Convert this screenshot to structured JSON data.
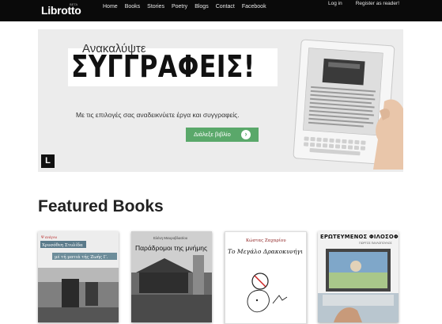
{
  "header": {
    "logo": "Librotto",
    "beta": "BETA",
    "nav": [
      "Home",
      "Books",
      "Stories",
      "Poetry",
      "Blogs",
      "Contact",
      "Facebook"
    ],
    "login": "Log in",
    "register": "Register as reader!"
  },
  "hero": {
    "subtitle": "Ανακαλύψτε",
    "title": "ΣΥΓΓΡΑΦΕΙΣ!",
    "text": "Με τις επιλογές σας αναδεικνύετε έργα και συγγραφείς.",
    "button": "Διάλεξε βιβλίο",
    "badge": "L"
  },
  "featured": {
    "title": "Featured Books",
    "books": [
      {
        "publisher": "Ψ ανάγνω",
        "author": "Χρυσόθεη Στυλίδα",
        "title": "μέ τή ματιά τής Ζωής Γ."
      },
      {
        "author": "Ελένη Μαυροβλασίου",
        "title": "Παράδρομοι της μνήμης"
      },
      {
        "author": "Κώστας Ζαχαρίου",
        "title": "Το Μεγάλο Δρακοκυνήγι"
      },
      {
        "title": "ΕΡΩΤΕΥΜΕΝΟΣ ΦΙΛΟΣΟΦΟΣ",
        "author": "ΓΙΩΡΓΟΣ ΠΑΥΛΟΠΟΥΛΟΣ"
      }
    ]
  },
  "colors": {
    "accent": "#5aa86a",
    "topbar": "#0a0a0a"
  }
}
